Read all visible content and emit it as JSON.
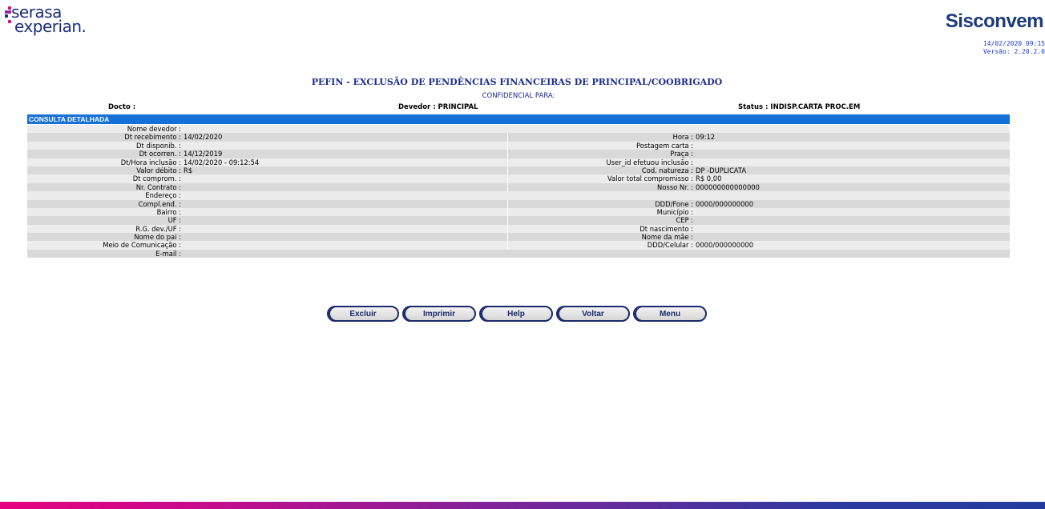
{
  "header": {
    "brand_line1": "serasa",
    "brand_line2": "experian.",
    "system_name": "Sisconvem",
    "datetime": "14/02/2020 09:15",
    "version": "Versão: 2.20.2.0"
  },
  "page": {
    "title": "PEFIN - EXCLUSÃO DE PENDÊNCIAS FINANCEIRAS DE PRINCIPAL/COOBRIGADO",
    "confidential": "CONFIDENCIAL PARA:",
    "docto": "Docto :",
    "devedor": "Devedor : PRINCIPAL",
    "status": "Status : INDISP.CARTA PROC.EM",
    "section": "CONSULTA DETALHADA"
  },
  "rows": [
    {
      "full": true,
      "label": "Nome devedor :",
      "value": ""
    },
    {
      "l_label": "Dt recebimento :",
      "l_value": "14/02/2020",
      "r_label": "Hora :",
      "r_value": "09:12"
    },
    {
      "l_label": "Dt disponib. :",
      "l_value": "",
      "r_label": "Postagem carta :",
      "r_value": ""
    },
    {
      "l_label": "Dt ocorren. :",
      "l_value": "14/12/2019",
      "r_label": "Praça :",
      "r_value": ""
    },
    {
      "l_label": "Dt/Hora inclusão :",
      "l_value": "14/02/2020 - 09:12:54",
      "r_label": "User_id efetuou inclusão :",
      "r_value": ""
    },
    {
      "l_label": "Valor débito :",
      "l_value": "R$",
      "r_label": "Cod. natureza :",
      "r_value": "DP -DUPLICATA"
    },
    {
      "l_label": "Dt comprom. :",
      "l_value": "",
      "r_label": "Valor total compromisso :",
      "r_value": "R$ 0,00"
    },
    {
      "l_label": "Nr. Contrato :",
      "l_value": "",
      "r_label": "Nosso Nr. :",
      "r_value": "000000000000000"
    },
    {
      "full": true,
      "label": "Endereço :",
      "value": ""
    },
    {
      "l_label": "Compl.end. :",
      "l_value": "",
      "r_label": "DDD/Fone :",
      "r_value": "0000/000000000"
    },
    {
      "l_label": "Bairro :",
      "l_value": "",
      "r_label": "Município :",
      "r_value": ""
    },
    {
      "l_label": "UF :",
      "l_value": "",
      "r_label": "CEP :",
      "r_value": ""
    },
    {
      "l_label": "R.G. dev./UF :",
      "l_value": "",
      "r_label": "Dt nascimento :",
      "r_value": ""
    },
    {
      "l_label": "Nome do pai :",
      "l_value": "",
      "r_label": "Nome da mãe :",
      "r_value": ""
    },
    {
      "l_label": "Meio de Comunicação :",
      "l_value": "",
      "r_label": "DDD/Celular :",
      "r_value": "0000/000000000"
    },
    {
      "full": true,
      "label": "E-mail :",
      "value": ""
    }
  ],
  "buttons": [
    "Excluir",
    "Imprimir",
    "Help",
    "Voltar",
    "Menu"
  ],
  "colors": {
    "section_header": "#1570d8",
    "title_text": "#1c2c8c",
    "brand_navy": "#1c2f7a"
  }
}
